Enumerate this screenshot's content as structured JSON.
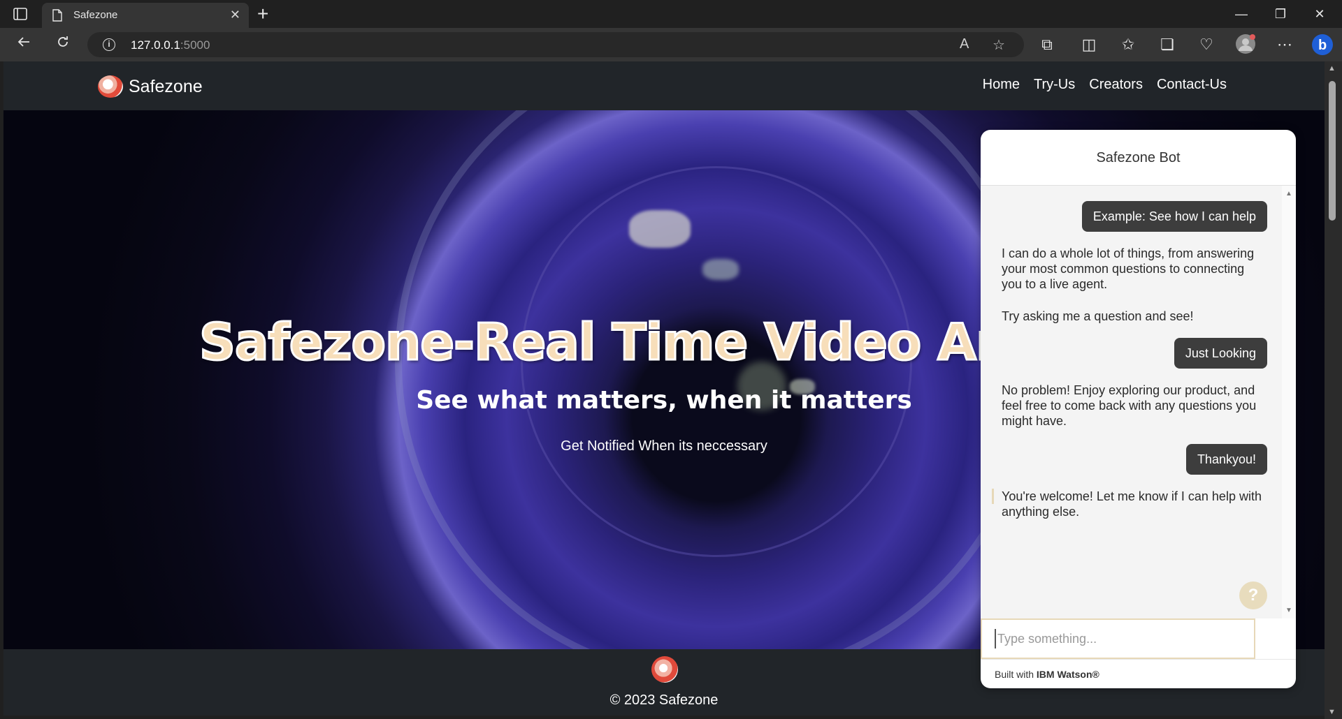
{
  "browser": {
    "tab_title": "Safezone",
    "tab_close": "✕",
    "new_tab": "+",
    "url_host": "127.0.0.1",
    "url_port": ":5000",
    "win_minimize": "—",
    "win_restore": "❐",
    "win_close": "✕"
  },
  "nav": {
    "brand": "Safezone",
    "links": [
      "Home",
      "Try-Us",
      "Creators",
      "Contact-Us"
    ]
  },
  "hero": {
    "title": "Safezone-Real Time Video Ana",
    "subtitle": "See what matters, when it matters",
    "note": "Get Notified When its neccessary"
  },
  "footer": {
    "copyright": "© 2023 Safezone"
  },
  "chat": {
    "header": "Safezone Bot",
    "messages": [
      {
        "from": "user",
        "text": "Example: See how I can help"
      },
      {
        "from": "bot",
        "text": "I can do a whole lot of things, from answering your most common questions to connecting you to a live agent."
      },
      {
        "from": "bot",
        "text": "Try asking me a question and see!"
      },
      {
        "from": "user",
        "text": "Just Looking"
      },
      {
        "from": "bot",
        "text": "No problem! Enjoy exploring our product, and feel free to come back with any questions you might have."
      },
      {
        "from": "user",
        "text": "Thankyou!"
      },
      {
        "from": "bot",
        "text": "You're welcome! Let me know if I can help with anything else."
      }
    ],
    "help_glyph": "?",
    "input_placeholder": "Type something...",
    "footer_prefix": "Built with ",
    "footer_brand": "IBM Watson®"
  },
  "colors": {
    "page_bg": "#212529",
    "title_fill": "#f7deba",
    "user_bubble": "#3d3d3d",
    "accent": "#e7d8b8"
  }
}
